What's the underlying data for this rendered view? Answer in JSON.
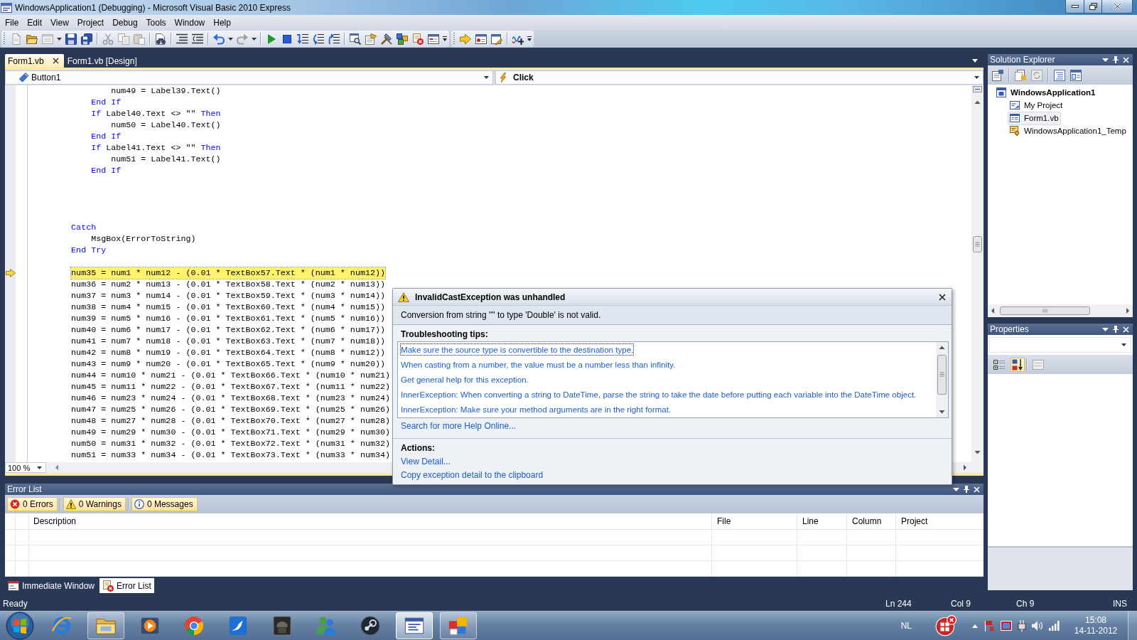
{
  "window": {
    "title": "WindowsApplication1 (Debugging) - Microsoft Visual Basic 2010 Express"
  },
  "menu": [
    "File",
    "Edit",
    "View",
    "Project",
    "Debug",
    "Tools",
    "Window",
    "Help"
  ],
  "document_tabs": [
    {
      "label": "Form1.vb",
      "selected": true
    },
    {
      "label": "Form1.vb [Design]",
      "selected": false
    }
  ],
  "navigation_bar": {
    "object": "Button1",
    "event": "Click"
  },
  "code_editor": {
    "lines": [
      {
        "kind": "code",
        "current": false,
        "parts": [
          {
            "kind": "plain",
            "text": "                num49 = Label39.Text()"
          }
        ]
      },
      {
        "kind": "code",
        "current": false,
        "parts": [
          {
            "kind": "keyword",
            "text": "            End If"
          }
        ]
      },
      {
        "kind": "code",
        "current": false,
        "parts": [
          {
            "kind": "keyword",
            "text": "            If"
          },
          {
            "kind": "plain",
            "text": " Label40.Text <> \"\" "
          },
          {
            "kind": "keyword",
            "text": "Then"
          }
        ]
      },
      {
        "kind": "code",
        "current": false,
        "parts": [
          {
            "kind": "plain",
            "text": "                num50 = Label40.Text()"
          }
        ]
      },
      {
        "kind": "code",
        "current": false,
        "parts": [
          {
            "kind": "keyword",
            "text": "            End If"
          }
        ]
      },
      {
        "kind": "code",
        "current": false,
        "parts": [
          {
            "kind": "keyword",
            "text": "            If"
          },
          {
            "kind": "plain",
            "text": " Label41.Text <> \"\" "
          },
          {
            "kind": "keyword",
            "text": "Then"
          }
        ]
      },
      {
        "kind": "code",
        "current": false,
        "parts": [
          {
            "kind": "plain",
            "text": "                num51 = Label41.Text()"
          }
        ]
      },
      {
        "kind": "code",
        "current": false,
        "parts": [
          {
            "kind": "keyword",
            "text": "            End If"
          }
        ]
      },
      {
        "kind": "blank",
        "current": false
      },
      {
        "kind": "blank",
        "current": false
      },
      {
        "kind": "blank",
        "current": false
      },
      {
        "kind": "blank",
        "current": false
      },
      {
        "kind": "code",
        "current": false,
        "parts": [
          {
            "kind": "keyword",
            "text": "        Catch"
          }
        ]
      },
      {
        "kind": "code",
        "current": false,
        "parts": [
          {
            "kind": "plain",
            "text": "            MsgBox(ErrorToString)"
          }
        ]
      },
      {
        "kind": "code",
        "current": false,
        "parts": [
          {
            "kind": "keyword",
            "text": "        End Try"
          }
        ]
      },
      {
        "kind": "blank",
        "current": false
      },
      {
        "kind": "code",
        "current": true,
        "parts": [
          {
            "kind": "plain",
            "text": "        num35 = num1 * num12 - (0.01 * TextBox57.Text * (num1 * num12))"
          }
        ]
      },
      {
        "kind": "code",
        "current": false,
        "parts": [
          {
            "kind": "plain",
            "text": "        num36 = num2 * num13 - (0.01 * TextBox58.Text * (num2 * num13))"
          }
        ]
      },
      {
        "kind": "code",
        "current": false,
        "parts": [
          {
            "kind": "plain",
            "text": "        num37 = num3 * num14 - (0.01 * TextBox59.Text * (num3 * num14))"
          }
        ]
      },
      {
        "kind": "code",
        "current": false,
        "parts": [
          {
            "kind": "plain",
            "text": "        num38 = num4 * num15 - (0.01 * TextBox60.Text * (num4 * num15))"
          }
        ]
      },
      {
        "kind": "code",
        "current": false,
        "parts": [
          {
            "kind": "plain",
            "text": "        num39 = num5 * num16 - (0.01 * TextBox61.Text * (num5 * num16))"
          }
        ]
      },
      {
        "kind": "code",
        "current": false,
        "parts": [
          {
            "kind": "plain",
            "text": "        num40 = num6 * num17 - (0.01 * TextBox62.Text * (num6 * num17))"
          }
        ]
      },
      {
        "kind": "code",
        "current": false,
        "parts": [
          {
            "kind": "plain",
            "text": "        num41 = num7 * num18 - (0.01 * TextBox63.Text * (num7 * num18))"
          }
        ]
      },
      {
        "kind": "code",
        "current": false,
        "parts": [
          {
            "kind": "plain",
            "text": "        num42 = num8 * num19 - (0.01 * TextBox64.Text * (num8 * num12))"
          }
        ]
      },
      {
        "kind": "code",
        "current": false,
        "parts": [
          {
            "kind": "plain",
            "text": "        num43 = num9 * num20 - (0.01 * TextBox65.Text * (num9 * num20))"
          }
        ]
      },
      {
        "kind": "code",
        "current": false,
        "parts": [
          {
            "kind": "plain",
            "text": "        num44 = num10 * num21 - (0.01 * TextBox66.Text * (num10 * num21)"
          }
        ]
      },
      {
        "kind": "code",
        "current": false,
        "parts": [
          {
            "kind": "plain",
            "text": "        num45 = num11 * num22 - (0.01 * TextBox67.Text * (num11 * num22)"
          }
        ]
      },
      {
        "kind": "code",
        "current": false,
        "parts": [
          {
            "kind": "plain",
            "text": "        num46 = num23 * num24 - (0.01 * TextBox68.Text * (num23 * num24)"
          }
        ]
      },
      {
        "kind": "code",
        "current": false,
        "parts": [
          {
            "kind": "plain",
            "text": "        num47 = num25 * num26 - (0.01 * TextBox69.Text * (num25 * num26)"
          }
        ]
      },
      {
        "kind": "code",
        "current": false,
        "parts": [
          {
            "kind": "plain",
            "text": "        num48 = num27 * num28 - (0.01 * TextBox70.Text * (num27 * num28)"
          }
        ]
      },
      {
        "kind": "code",
        "current": false,
        "parts": [
          {
            "kind": "plain",
            "text": "        num49 = num29 * num30 - (0.01 * TextBox71.Text * (num29 * num30)"
          }
        ]
      },
      {
        "kind": "code",
        "current": false,
        "parts": [
          {
            "kind": "plain",
            "text": "        num50 = num31 * num32 - (0.01 * TextBox72.Text * (num31 * num32)"
          }
        ]
      },
      {
        "kind": "code",
        "current": false,
        "parts": [
          {
            "kind": "plain",
            "text": "        num51 = num33 * num34 - (0.01 * TextBox73.Text * (num33 * num34)"
          }
        ]
      }
    ],
    "zoom": "100 %"
  },
  "exception_helper": {
    "title": "InvalidCastException was unhandled",
    "message": "Conversion from string \"\" to type 'Double' is not valid.",
    "tips_heading": "Troubleshooting tips:",
    "tips": [
      {
        "text": "Make sure the source type is convertible to the destination type.",
        "focused": true
      },
      {
        "text": "When casting from a number, the value must be a number less than infinity.",
        "focused": false
      },
      {
        "text": "Get general help for this exception.",
        "focused": false
      },
      {
        "text": "InnerException: When converting a string to DateTime, parse the string to take the date before putting each variable into the DateTime object.",
        "focused": false
      },
      {
        "text": "InnerException: Make sure your method arguments are in the right format.",
        "focused": false
      }
    ],
    "help_link": "Search for more Help Online...",
    "actions_heading": "Actions:",
    "actions": [
      "View Detail...",
      "Copy exception detail to the clipboard"
    ]
  },
  "solution_explorer": {
    "title": "Solution Explorer",
    "tree": [
      {
        "label": "WindowsApplication1",
        "kind": "project",
        "selected": false,
        "children": [
          {
            "label": "My Project",
            "kind": "settings",
            "selected": false
          },
          {
            "label": "Form1.vb",
            "kind": "form",
            "selected": true
          },
          {
            "label": "WindowsApplication1_Temp",
            "kind": "key",
            "selected": false
          }
        ]
      }
    ]
  },
  "properties": {
    "title": "Properties",
    "sort_buttons": [
      {
        "kind": "categorized",
        "selected": false
      },
      {
        "kind": "alphabetical",
        "selected": true
      }
    ]
  },
  "error_list": {
    "title": "Error List",
    "filters": [
      {
        "kind": "error",
        "label": "0 Errors",
        "on": true
      },
      {
        "kind": "warning",
        "label": "0 Warnings",
        "on": true
      },
      {
        "kind": "message",
        "label": "0 Messages",
        "on": true
      }
    ],
    "columns": [
      "Description",
      "File",
      "Line",
      "Column",
      "Project"
    ]
  },
  "tool_tabs": [
    {
      "kind": "immediate",
      "label": "Immediate Window",
      "selected": false
    },
    {
      "kind": "errors",
      "label": "Error List",
      "selected": true
    }
  ],
  "status_bar": {
    "message": "Ready",
    "line": "Ln 244",
    "column": "Col 9",
    "char": "Ch 9",
    "mode": "INS"
  },
  "taskbar": {
    "apps": [
      {
        "open": false,
        "active": false
      },
      {
        "open": true,
        "active": false
      },
      {
        "open": false,
        "active": false
      },
      {
        "open": false,
        "active": false
      },
      {
        "open": false,
        "active": false
      },
      {
        "open": false,
        "active": false
      },
      {
        "open": false,
        "active": false
      },
      {
        "open": false,
        "active": false
      },
      {
        "open": true,
        "active": true
      },
      {
        "open": true,
        "active": false
      }
    ],
    "language": "NL",
    "time": "15:08",
    "date": "14-11-2012"
  }
}
